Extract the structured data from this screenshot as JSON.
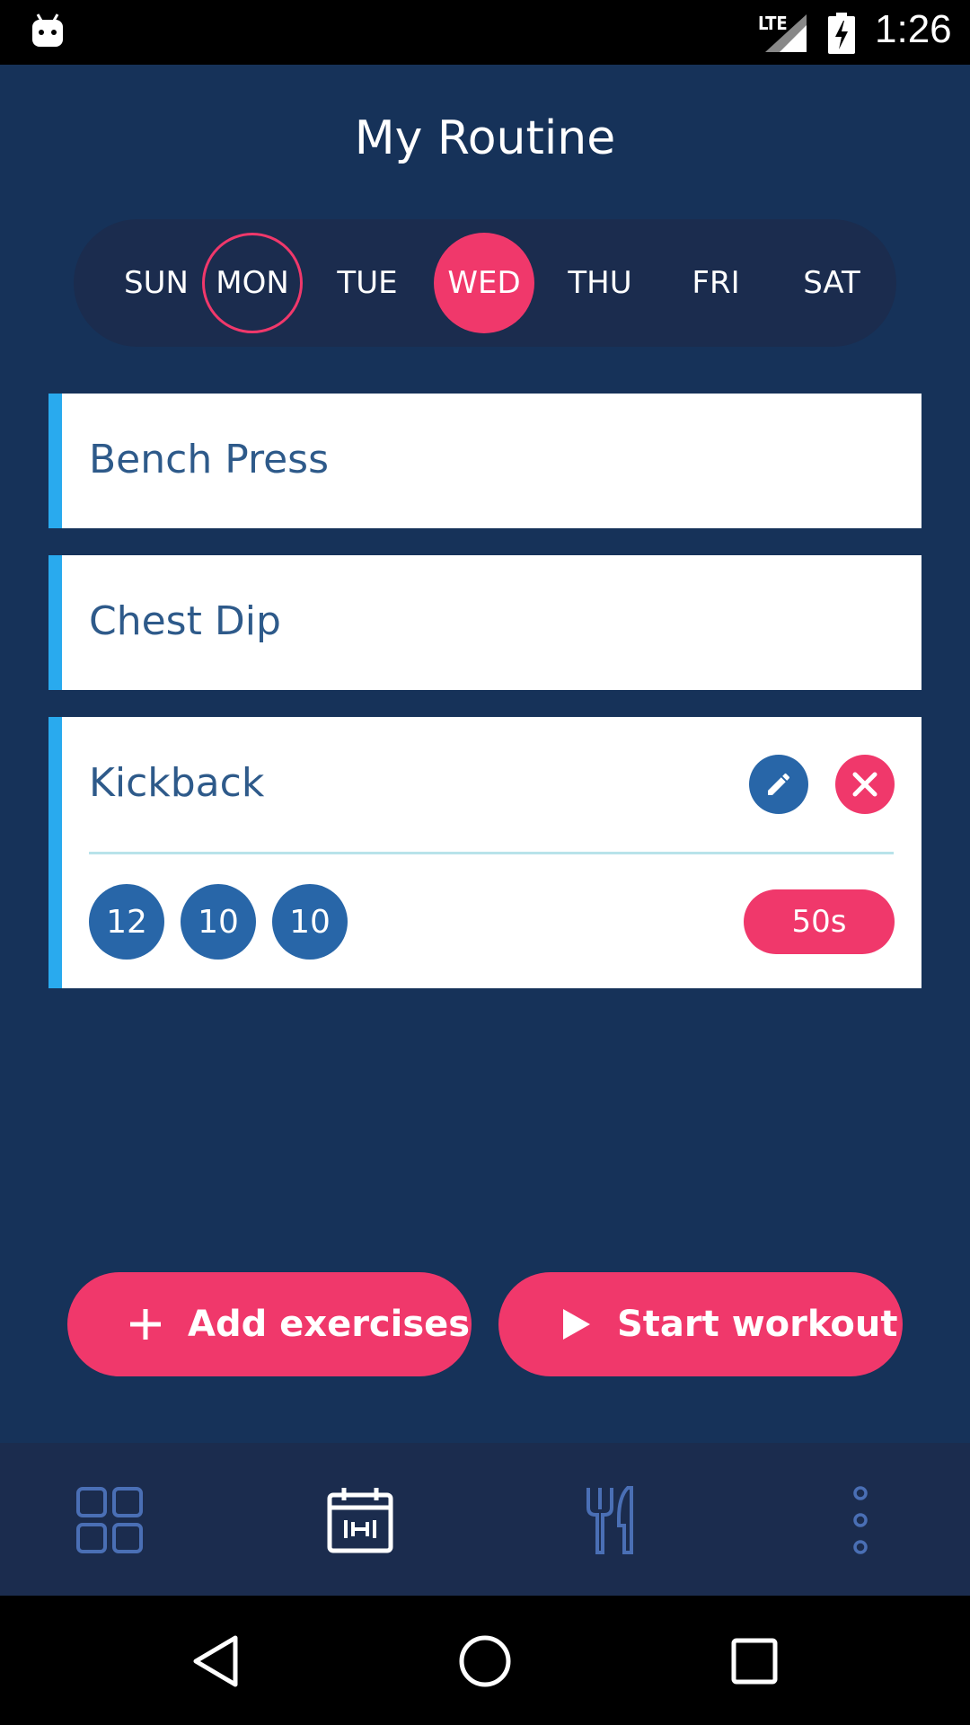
{
  "status_bar": {
    "network": "LTE",
    "time": "1:26",
    "icons": [
      "android-icon",
      "signal-icon",
      "battery-charging-icon"
    ]
  },
  "page": {
    "title": "My Routine"
  },
  "days": [
    {
      "label": "SUN",
      "state": "default"
    },
    {
      "label": "MON",
      "state": "outlined"
    },
    {
      "label": "TUE",
      "state": "default"
    },
    {
      "label": "WED",
      "state": "selected"
    },
    {
      "label": "THU",
      "state": "default"
    },
    {
      "label": "FRI",
      "state": "default"
    },
    {
      "label": "SAT",
      "state": "default"
    }
  ],
  "exercises": [
    {
      "name": "Bench Press",
      "expanded": false
    },
    {
      "name": "Chest Dip",
      "expanded": false
    },
    {
      "name": "Kickback",
      "expanded": true,
      "reps": [
        "12",
        "10",
        "10"
      ],
      "rest": "50s"
    }
  ],
  "actions": {
    "add_label": "Add exercises",
    "start_label": "Start workout"
  },
  "bottom_nav": {
    "items": [
      "dashboard-icon",
      "calendar-workout-icon",
      "fork-knife-icon",
      "more-vertical-icon"
    ],
    "active": "calendar-workout-icon"
  },
  "colors": {
    "background": "#163259",
    "panel": "#1b2c4e",
    "accent": "#f0386b",
    "blue": "#2866a8",
    "card_stripe": "#29aaee"
  }
}
